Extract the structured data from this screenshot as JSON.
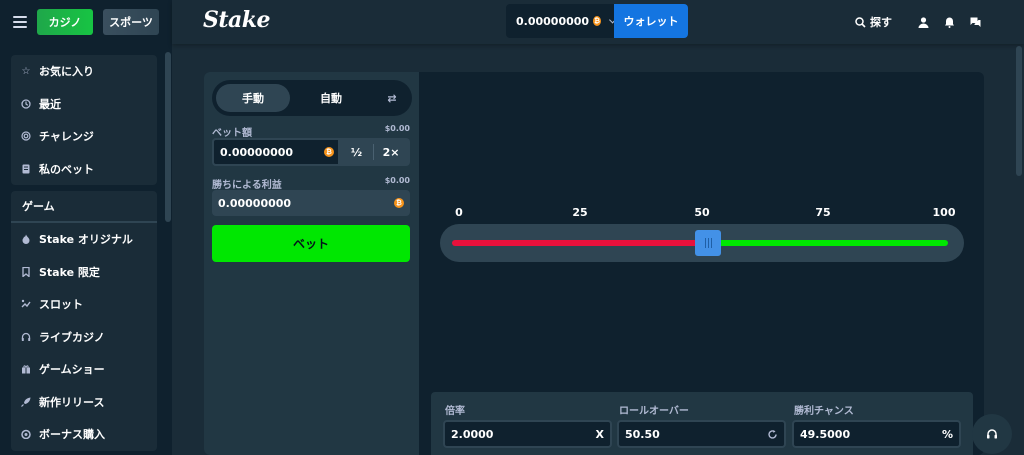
{
  "sidebar": {
    "casino_label": "カジノ",
    "sports_label": "スポーツ",
    "group1": [
      {
        "label": "お気に入り",
        "icon": "star-icon"
      },
      {
        "label": "最近",
        "icon": "history-icon"
      },
      {
        "label": "チャレンジ",
        "icon": "target-icon"
      },
      {
        "label": "私のベット",
        "icon": "receipt-icon"
      }
    ],
    "games_heading": "ゲーム",
    "group2": [
      {
        "label": "Stake オリジナル",
        "icon": "flame-icon"
      },
      {
        "label": "Stake 限定",
        "icon": "bookmark-icon"
      },
      {
        "label": "スロット",
        "icon": "slots-icon"
      },
      {
        "label": "ライブカジノ",
        "icon": "headset-icon"
      },
      {
        "label": "ゲームショー",
        "icon": "gift-icon"
      },
      {
        "label": "新作リリース",
        "icon": "rocket-icon"
      },
      {
        "label": "ボーナス購入",
        "icon": "coin-bag-icon"
      }
    ]
  },
  "header": {
    "logo": "Stake",
    "balance": "0.00000000",
    "currency_icon": "bitcoin-icon",
    "wallet_label": "ウォレット",
    "search_label": "探す"
  },
  "bet_panel": {
    "tab_manual": "手動",
    "tab_auto": "自動",
    "bet_amount_label": "ベット額",
    "bet_amount_usd": "$0.00",
    "bet_amount_value": "0.00000000",
    "half_label": "½",
    "double_label": "2×",
    "profit_label": "勝ちによる利益",
    "profit_usd": "$0.00",
    "profit_value": "0.00000000",
    "bet_button": "ベット"
  },
  "slider": {
    "ticks": [
      "0",
      "25",
      "50",
      "75",
      "100"
    ],
    "value": 50.5,
    "lose_color": "#e9113c",
    "win_color": "#00e701"
  },
  "stats": {
    "multiplier_label": "倍率",
    "multiplier_value": "2.0000",
    "multiplier_suffix": "X",
    "rollover_label": "ロールオーバー",
    "rollover_value": "50.50",
    "win_chance_label": "勝利チャンス",
    "win_chance_value": "49.5000",
    "win_chance_suffix": "%"
  },
  "colors": {
    "accent_green": "#00e701",
    "wallet_blue": "#1475e1",
    "bg": "#1a2c38"
  }
}
